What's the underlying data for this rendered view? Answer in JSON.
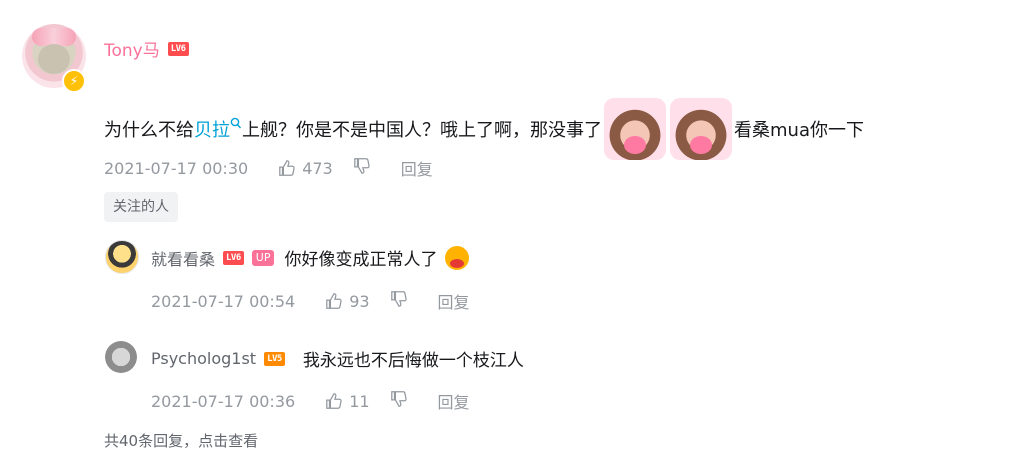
{
  "comment": {
    "username": "Tony马",
    "level": "LV6",
    "text_before_link": "为什么不给",
    "link_text": "贝拉",
    "search_icon": "search-icon",
    "text_after_link": "上舰？你是不是中国人？哦上了啊，那没事了",
    "text_after_stickers": "看桑mua你一下",
    "date": "2021-07-17 00:30",
    "likes": "473",
    "reply_label": "回复",
    "tag": "关注的人"
  },
  "replies": [
    {
      "username": "就看看桑",
      "level": "LV6",
      "badge": "UP",
      "text": "你好像变成正常人了",
      "date": "2021-07-17 00:54",
      "likes": "93",
      "reply_label": "回复"
    },
    {
      "username": "Psycholog1st",
      "level": "LV5",
      "text": "我永远也不后悔做一个枝江人",
      "date": "2021-07-17 00:36",
      "likes": "11",
      "reply_label": "回复"
    }
  ],
  "footer": {
    "text": "共40条回复，点击查看"
  },
  "colors": {
    "username": "#fb7299",
    "link": "#00a1d6",
    "meta": "#9499a0",
    "level6": "#ff4d4f",
    "level5": "#ff8a00"
  }
}
